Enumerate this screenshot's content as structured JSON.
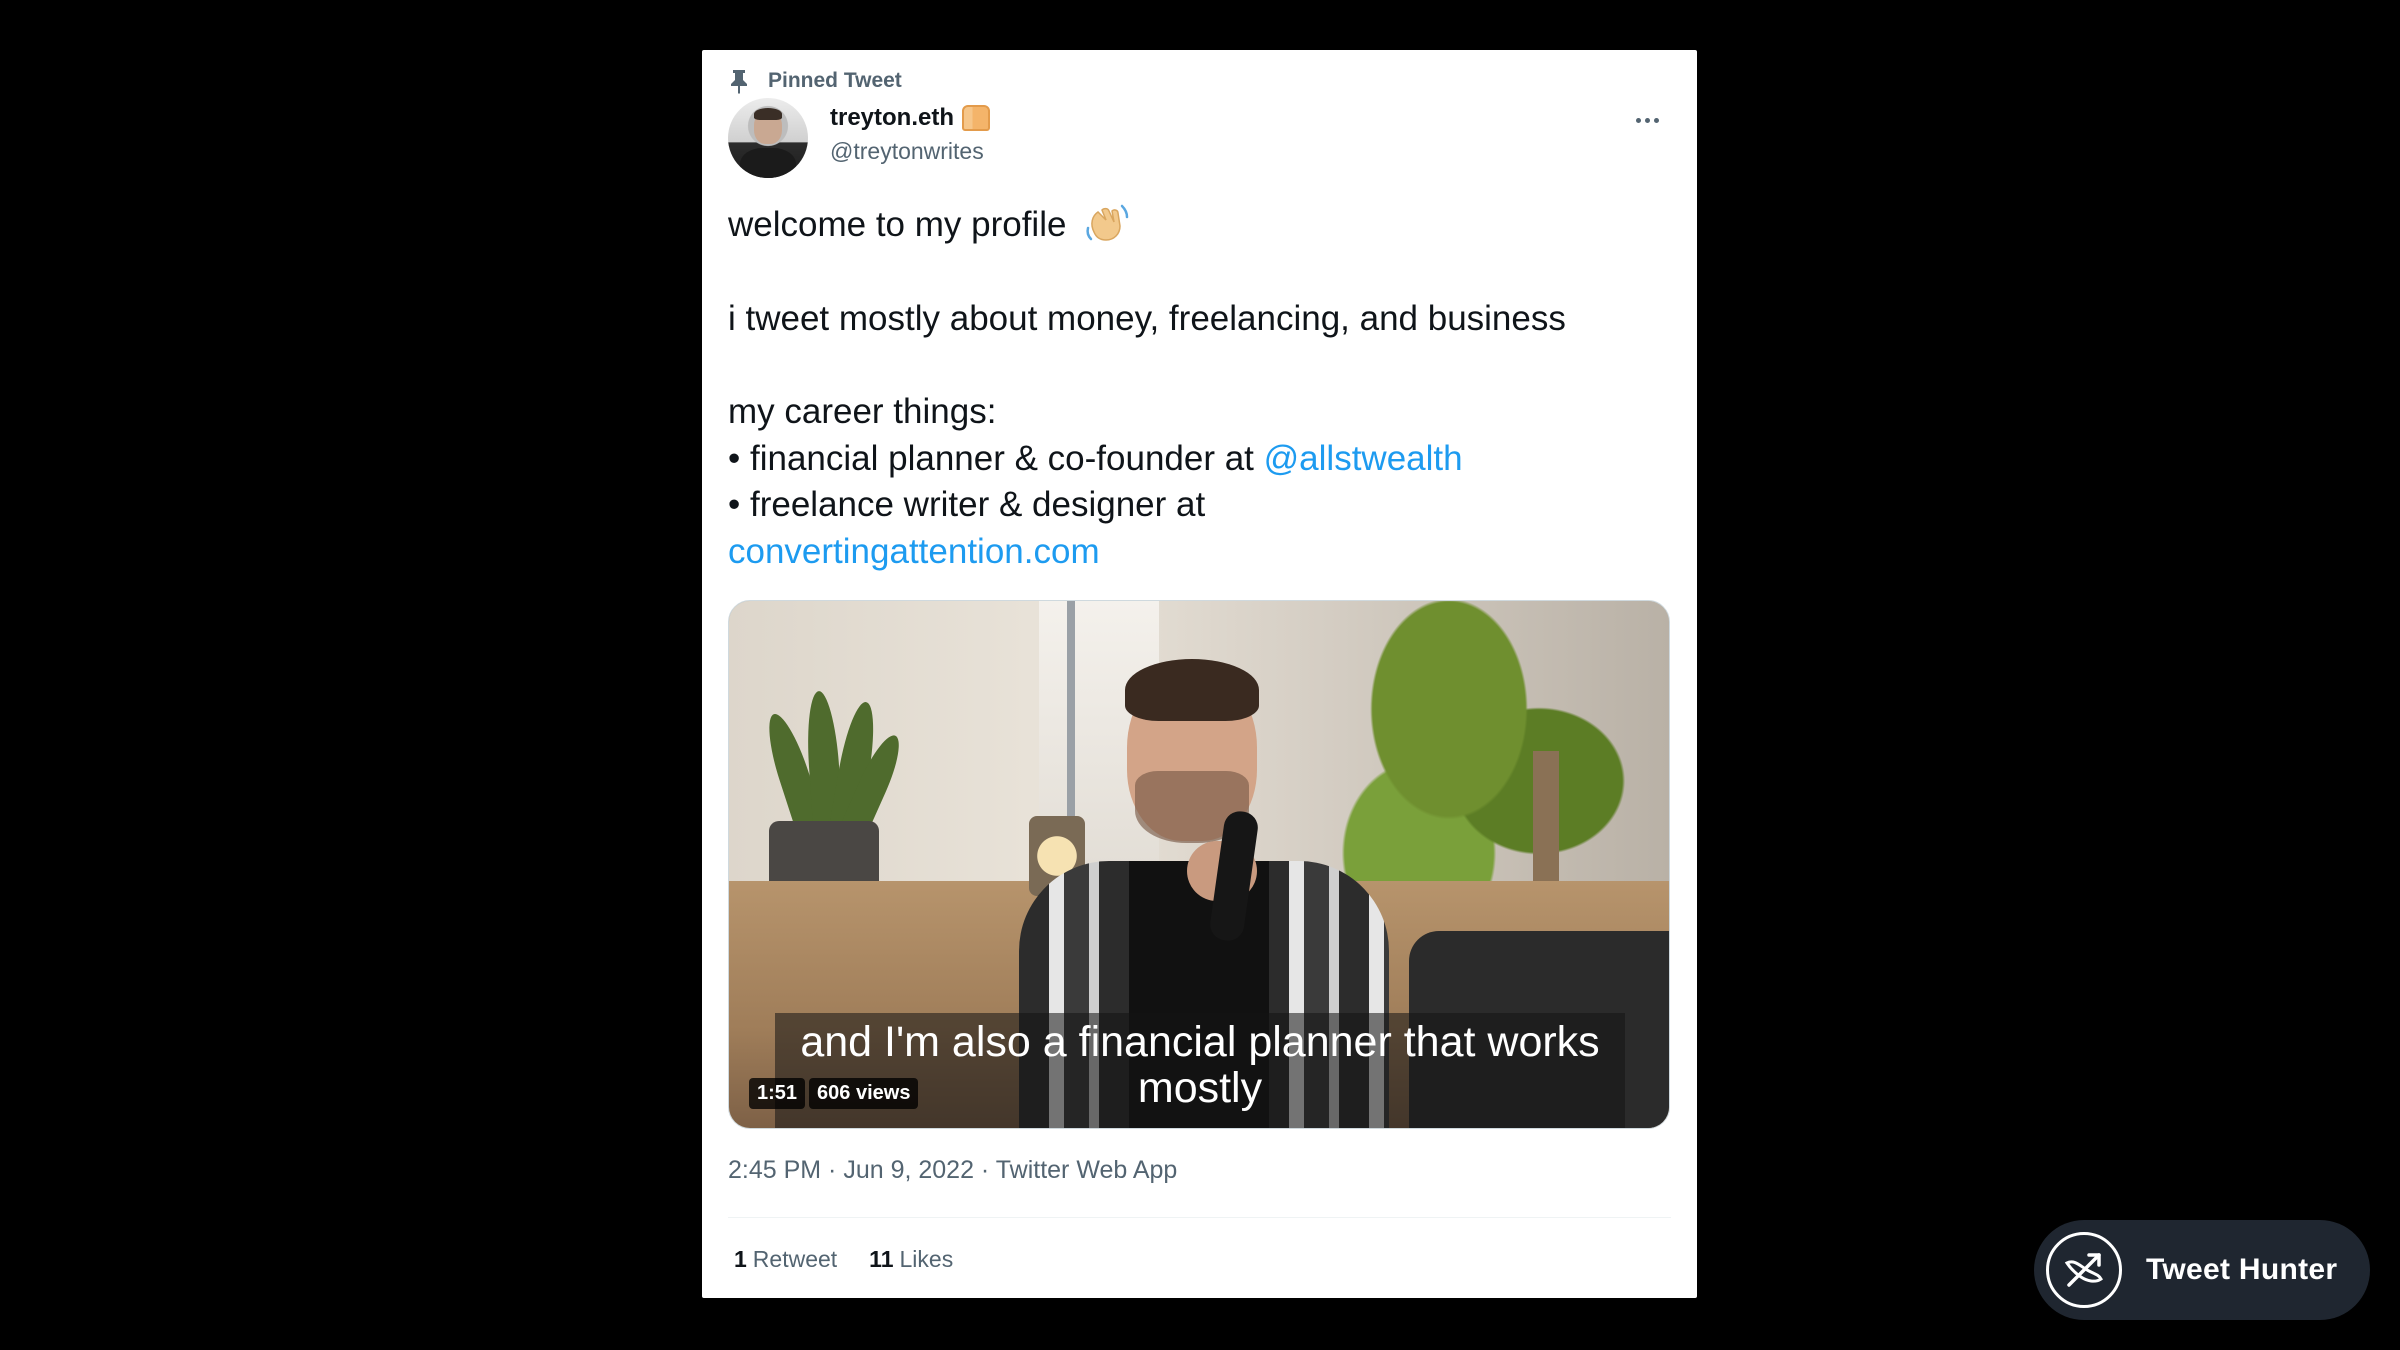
{
  "tweet": {
    "pinned_label": "Pinned Tweet",
    "author": {
      "display_name": "treyton.eth",
      "handle": "@treytonwrites"
    },
    "text": {
      "line1": "welcome to my profile",
      "line2": "i tweet mostly about money, freelancing, and business",
      "line3": "my career things:",
      "line4_prefix": "• financial planner & co-founder at ",
      "line4_link": "@allstwealth",
      "line5": "• freelance writer & designer at",
      "line6_link": "convertingattention.com"
    },
    "media": {
      "caption": "and I'm also a financial planner that works mostly",
      "duration": "1:51",
      "views": "606 views"
    },
    "meta": "2:45 PM · Jun 9, 2022 · Twitter Web App",
    "stats": {
      "retweets_count": "1",
      "retweets_label": "Retweet",
      "likes_count": "11",
      "likes_label": "Likes"
    }
  },
  "brand": {
    "name": "Tweet Hunter"
  },
  "colors": {
    "link": "#1d9bf0",
    "secondary_text": "#536471",
    "primary_text": "#0f1419",
    "background": "#000000",
    "brand_pill": "#1f2630"
  },
  "icons": {
    "pin": "pin-icon",
    "verified_emoji": "bread-icon",
    "wave": "waving-hand-icon",
    "more": "more-icon",
    "brand": "tweet-hunter-logo-icon"
  }
}
